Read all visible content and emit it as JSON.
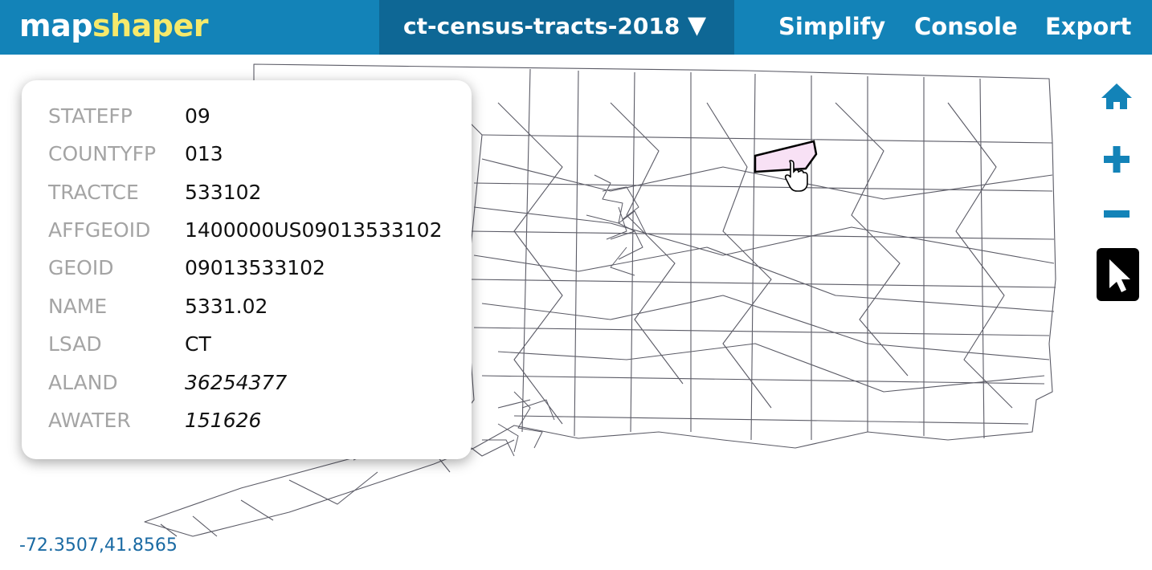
{
  "app": {
    "logo_part1": "map",
    "logo_part2": "shaper",
    "layer_name": "ct-census-tracts-2018",
    "layer_dropdown_icon": "triangle-down-icon",
    "menu": {
      "simplify": "Simplify",
      "console": "Console",
      "export": "Export"
    },
    "colors": {
      "header_bg": "#1383b8",
      "layer_bg": "#0e6795",
      "logo_accent": "#f6e96b",
      "selected_fill": "#f8e1f5",
      "tract_stroke": "#5b5b66"
    }
  },
  "popup": {
    "rows": [
      {
        "key": "STATEFP",
        "value": "09"
      },
      {
        "key": "COUNTYFP",
        "value": "013"
      },
      {
        "key": "TRACTCE",
        "value": "533102"
      },
      {
        "key": "AFFGEOID",
        "value": "1400000US09013533102"
      },
      {
        "key": "GEOID",
        "value": "09013533102"
      },
      {
        "key": "NAME",
        "value": "5331.02"
      },
      {
        "key": "LSAD",
        "value": "CT"
      },
      {
        "key": "ALAND",
        "value": "36254377"
      },
      {
        "key": "AWATER",
        "value": "151626"
      }
    ]
  },
  "controls": {
    "home": "home-icon",
    "zoom_in": "plus-icon",
    "zoom_out": "minus-icon",
    "select": "pointer-arrow-icon"
  },
  "status": {
    "coordinates": "-72.3507,41.8565"
  }
}
